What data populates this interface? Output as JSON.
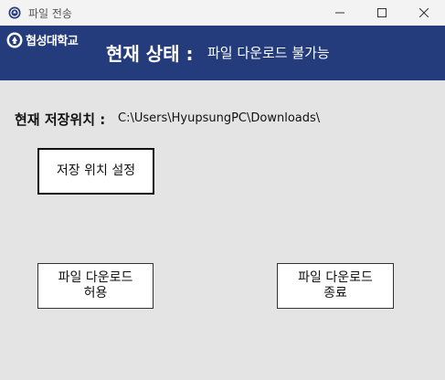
{
  "window": {
    "title": "파일 전송",
    "icons": [
      "app-icon",
      "minimize-icon",
      "maximize-icon",
      "close-icon"
    ]
  },
  "header": {
    "logo_text": "협성대학교",
    "status_label": "현재 상태 :",
    "status_value": "파일 다운로드 불가능",
    "colors": {
      "header_bg": "#243c7c",
      "header_text": "#ffffff"
    }
  },
  "main": {
    "path_label": "현재 저장위치 :",
    "path_value": "C:\\Users\\HyupsungPC\\Downloads\\",
    "set_path_button": "저장 위치 설정",
    "allow_button": [
      "파일 다운로드",
      "허용"
    ],
    "stop_button": [
      "파일 다운로드",
      "종료"
    ],
    "colors": {
      "background": "#e4e4e4",
      "button_bg": "#ffffff"
    }
  }
}
